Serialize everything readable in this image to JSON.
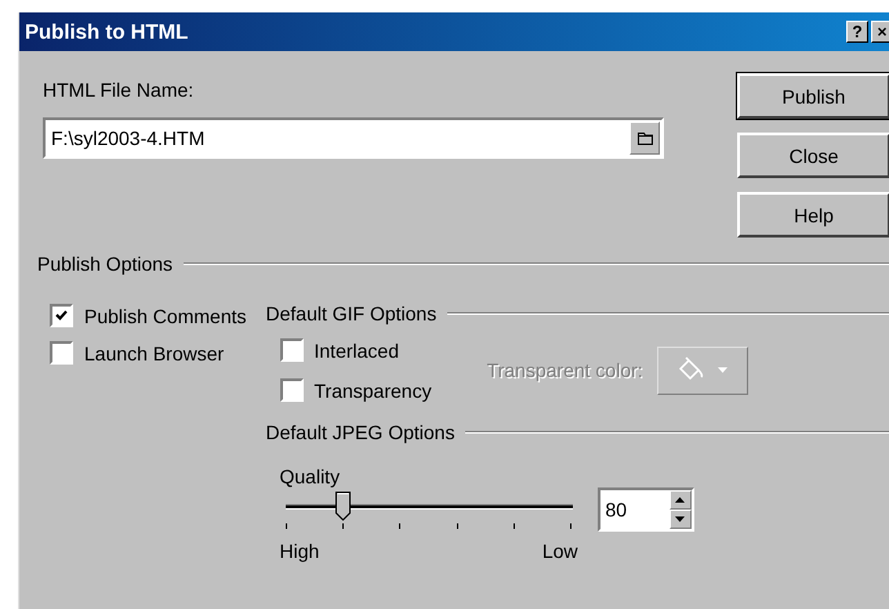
{
  "window": {
    "title": "Publish to HTML",
    "title_buttons": [
      "?",
      "×"
    ]
  },
  "file_name": {
    "label": "HTML File Name:",
    "value": "F:\\syl2003-4.HTM"
  },
  "buttons": [
    {
      "label": "Publish",
      "default": true
    },
    {
      "label": "Close",
      "default": false
    },
    {
      "label": "Help",
      "default": false
    }
  ],
  "publish_options": {
    "title": "Publish Options",
    "checkboxes": [
      {
        "label": "Publish Comments",
        "checked": true
      },
      {
        "label": "Launch Browser",
        "checked": false
      }
    ]
  },
  "gif_options": {
    "title": "Default GIF Options",
    "checkboxes": [
      {
        "label": "Interlaced",
        "checked": false
      },
      {
        "label": "Transparency",
        "checked": false
      }
    ],
    "transparent_color": {
      "label": "Transparent color:",
      "disabled": true
    }
  },
  "jpeg_options": {
    "title": "Default JPEG Options",
    "quality": {
      "label": "Quality",
      "level": 0.2,
      "value": "80",
      "min_label": "High",
      "max_label": "Low"
    }
  }
}
